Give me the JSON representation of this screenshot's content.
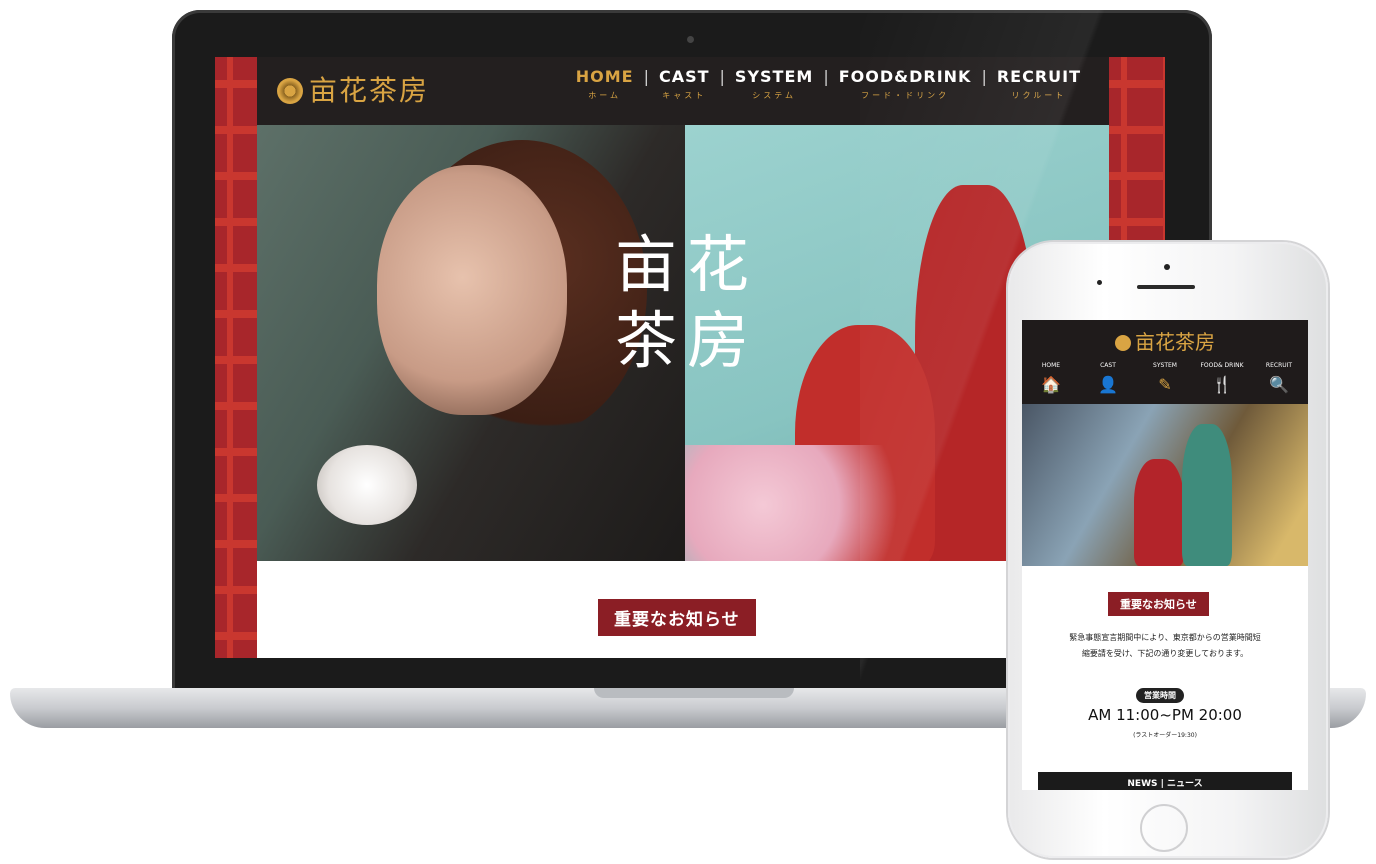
{
  "desktop": {
    "logo_text": "亩花茶房",
    "nav": [
      {
        "en": "HOME",
        "jp": "ホーム",
        "active": true
      },
      {
        "en": "CAST",
        "jp": "キャスト",
        "active": false
      },
      {
        "en": "SYSTEM",
        "jp": "システム",
        "active": false
      },
      {
        "en": "FOOD&DRINK",
        "jp": "フード・ドリンク",
        "active": false
      },
      {
        "en": "RECRUIT",
        "jp": "リクルート",
        "active": false
      }
    ],
    "separator": "|",
    "hero_title_line1": "亩花",
    "hero_title_line2": "茶房",
    "notice_label": "重要なお知らせ"
  },
  "mobile": {
    "logo_text": "亩花茶房",
    "nav": [
      {
        "label": "HOME",
        "icon": "🏠"
      },
      {
        "label": "CAST",
        "icon": "👤"
      },
      {
        "label": "SYSTEM",
        "icon": "✎"
      },
      {
        "label": "FOOD& DRINK",
        "icon": "🍴"
      },
      {
        "label": "RECRUIT",
        "icon": "🔍"
      }
    ],
    "notice_label": "重要なお知らせ",
    "notice_text_line1": "緊急事態宣言期間中により、東京都からの営業時間短",
    "notice_text_line2": "縮要請を受け、下記の通り変更しております。",
    "hours_label": "営業時間",
    "hours": "AM 11:00~PM 20:00",
    "last_order": "(ラストオーダー19:30)",
    "news_label": "NEWS | ニュース"
  },
  "colors": {
    "gold": "#d9a443",
    "dark": "#231f1f",
    "crimson": "#8b1e25",
    "border_red": "#a8262b"
  }
}
